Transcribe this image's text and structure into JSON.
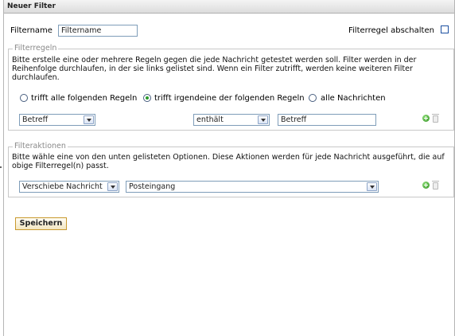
{
  "window": {
    "title": "Neuer Filter"
  },
  "filter_name": {
    "label": "Filtername",
    "value": "Filtername"
  },
  "disable_rule": {
    "label": "Filterregel abschalten",
    "checked": false
  },
  "rules": {
    "legend": "Filterregeln",
    "description": "Bitte erstelle eine oder mehrere Regeln gegen die jede Nachricht getestet werden soll. Filter werden in der Reihenfolge durchlaufen, in der sie links gelistet sind. Wenn ein Filter zutrifft, werden keine weiteren Filter durchlaufen.",
    "match_options": [
      {
        "label": "trifft alle folgenden Regeln",
        "checked": false
      },
      {
        "label": "trifft irgendeine der folgenden Regeln",
        "checked": true
      },
      {
        "label": "alle Nachrichten",
        "checked": false
      }
    ],
    "row": {
      "field": "Betreff",
      "operator": "enthält",
      "value": "Betreff"
    }
  },
  "actions": {
    "legend": "Filteraktionen",
    "description": "Bitte wähle eine von den unten gelisteten Optionen. Diese Aktionen werden für jede Nachricht ausgeführt, die auf obige Filterregel(n) passt.",
    "row": {
      "action": "Verschiebe Nachricht",
      "target": "Posteingang"
    }
  },
  "save_label": "Speichern",
  "icons": {
    "add": "plus-circle-icon",
    "delete": "trash-icon"
  }
}
